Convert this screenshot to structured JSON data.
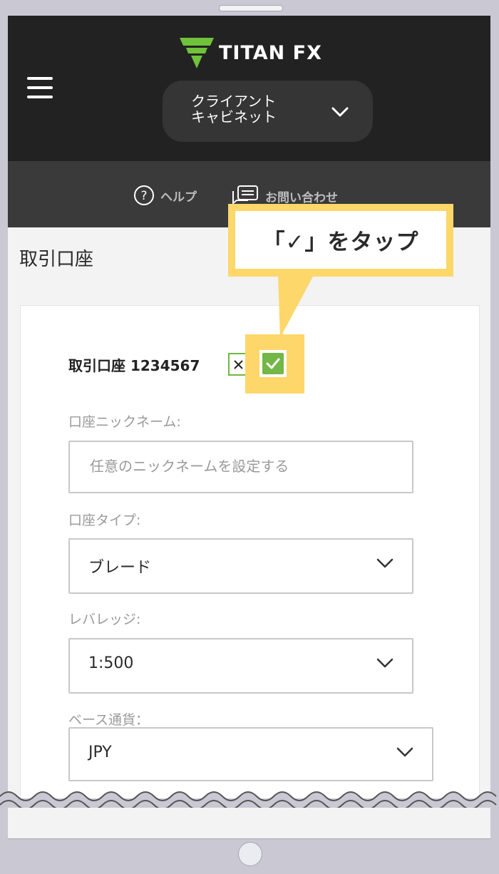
{
  "header": {
    "logo_text": "TITAN FX",
    "client_button_label": "クライアント\nキャビネット"
  },
  "subnav": {
    "help_label": "ヘルプ",
    "contact_label": "お問い合わせ"
  },
  "page": {
    "title": "取引口座"
  },
  "account": {
    "title": "取引口座 1234567"
  },
  "form": {
    "nickname_label": "口座ニックネーム:",
    "nickname_placeholder": "任意のニックネームを設定する",
    "nickname_value": "",
    "account_type_label": "口座タイプ:",
    "account_type_value": "ブレード",
    "leverage_label": "レバレッジ:",
    "leverage_value": "1:500",
    "currency_label": "ベース通貨：",
    "currency_value": "JPY"
  },
  "callout": {
    "text": "「✓」をタップ"
  },
  "colors": {
    "header_bg": "#222222",
    "subnav_bg": "#3a3a3a",
    "accent_green": "#72b747",
    "highlight_yellow": "#fdd76a",
    "frame": "#c9c8d3"
  },
  "icons": {
    "menu": "hamburger-icon",
    "logo": "titan-logo-icon",
    "dropdown": "chevron-down-icon",
    "help": "help-circle-icon",
    "contact": "chat-icon",
    "confirm": "check-icon",
    "cancel": "close-icon"
  }
}
